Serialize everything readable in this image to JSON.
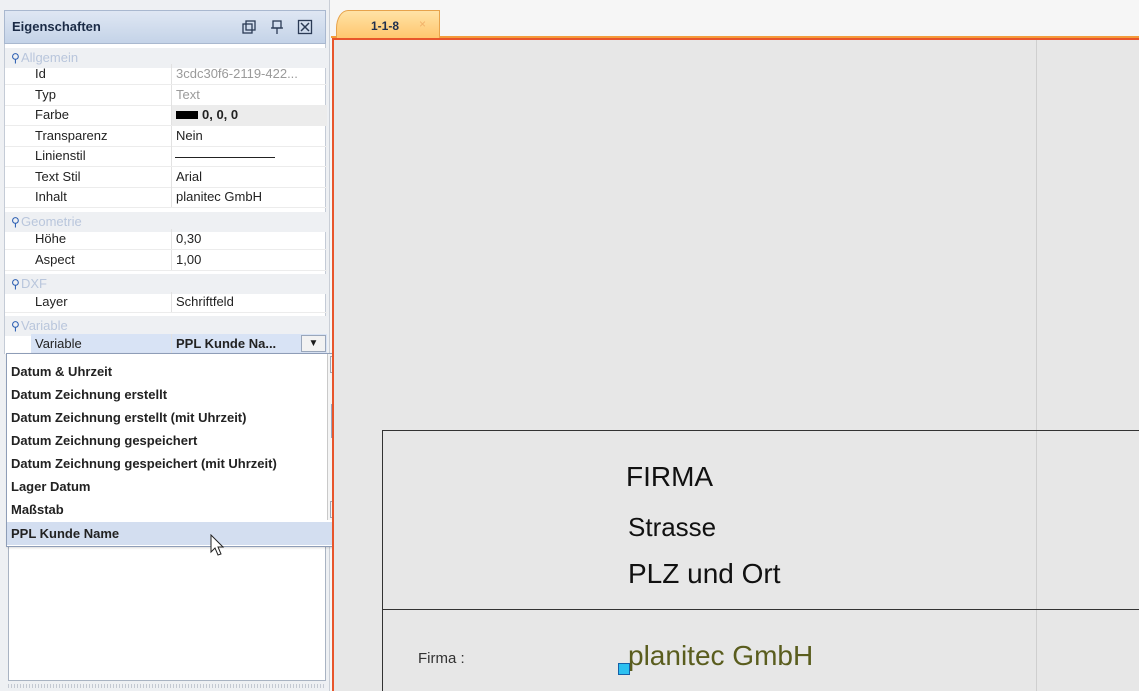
{
  "panel": {
    "title": "Eigenschaften",
    "header_icons": [
      "restore-window-icon",
      "pin-icon",
      "close-box-icon"
    ],
    "categories": {
      "allgemein": "Allgemein",
      "geometrie": "Geometrie",
      "dxf": "DXF",
      "variable": "Variable"
    },
    "rows": {
      "id": {
        "key": "Id",
        "value": "3cdc30f6-2119-422..."
      },
      "typ": {
        "key": "Typ",
        "value": "Text"
      },
      "farbe": {
        "key": "Farbe",
        "value": "0, 0, 0"
      },
      "transparenz": {
        "key": "Transparenz",
        "value": "Nein"
      },
      "linienstil": {
        "key": "Linienstil",
        "value": ""
      },
      "textstil": {
        "key": "Text Stil",
        "value": "Arial"
      },
      "inhalt": {
        "key": "Inhalt",
        "value": "planitec GmbH"
      },
      "hoehe": {
        "key": "Höhe",
        "value": "0,30"
      },
      "aspect": {
        "key": "Aspect",
        "value": "1,00"
      },
      "layer": {
        "key": "Layer",
        "value": "Schriftfeld"
      },
      "variable": {
        "key": "Variable",
        "value": "PPL Kunde Na..."
      }
    }
  },
  "dropdown": {
    "options": [
      "Datum & Uhrzeit",
      "Datum Zeichnung erstellt",
      "Datum Zeichnung erstellt (mit Uhrzeit)",
      "Datum Zeichnung gespeichert",
      "Datum Zeichnung gespeichert (mit Uhrzeit)",
      "Lager Datum",
      "Maßstab",
      "PPL Kunde Name"
    ],
    "selected": "PPL Kunde Name"
  },
  "tab": {
    "label": "1-1-8",
    "close": "×"
  },
  "drawing": {
    "firma_header": "FIRMA",
    "strasse": "Strasse",
    "plz_ort": "PLZ und Ort",
    "firma_label": "Firma :",
    "firma_value": "planitec GmbH"
  }
}
